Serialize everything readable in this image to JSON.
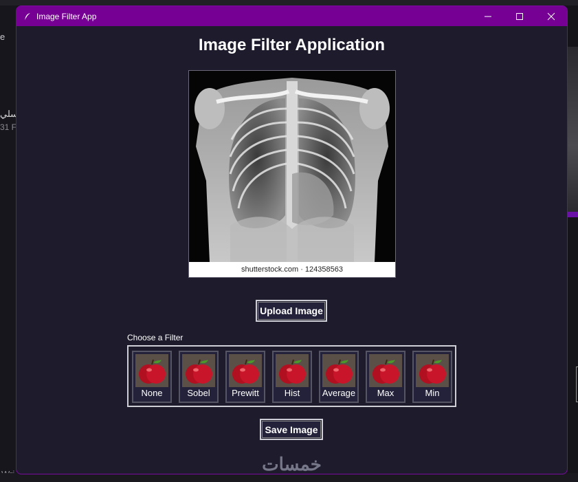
{
  "background": {
    "left_fragment_top": "e",
    "left_fragment_arabic": "سلي",
    "left_fragment_number": "31 F",
    "left_fragment_bottom": "Wri"
  },
  "window": {
    "title": "Image Filter App",
    "controls": [
      "minimize",
      "maximize",
      "close"
    ],
    "titlebar_color": "#760094"
  },
  "app": {
    "heading": "Image Filter Application",
    "image_caption": "shutterstock.com · 124358563",
    "upload_label": "Upload Image",
    "filter_section_label": "Choose a Filter",
    "filters": [
      "None",
      "Sobel",
      "Prewitt",
      "Hist",
      "Average",
      "Max",
      "Min"
    ],
    "save_label": "Save Image",
    "watermark": "خمسات"
  }
}
